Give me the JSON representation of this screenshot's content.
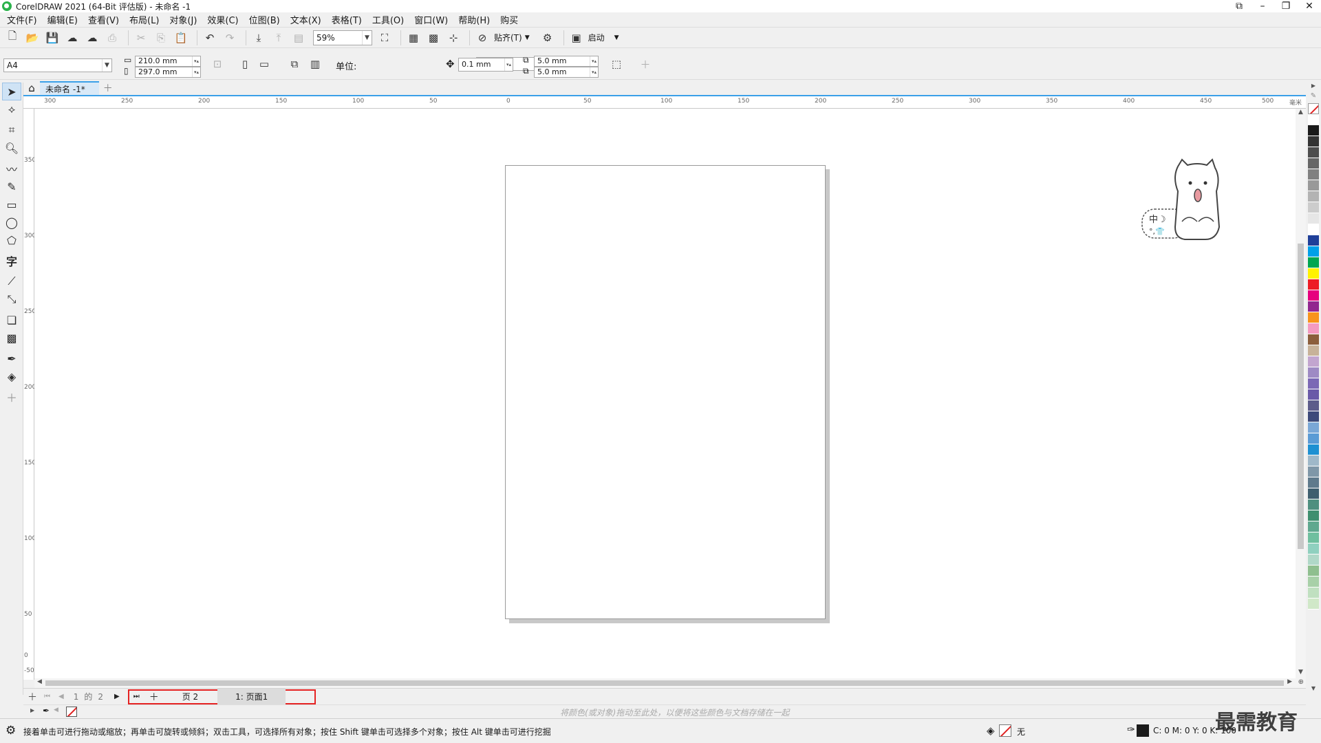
{
  "window": {
    "title": "CorelDRAW 2021 (64-Bit 评估版) - 未命名 -1",
    "app_icon": "coreldraw-logo",
    "controls": [
      "restore-icon",
      "minimize-icon",
      "maximize-icon",
      "close-icon"
    ]
  },
  "menu": {
    "items": [
      "文件(F)",
      "编辑(E)",
      "查看(V)",
      "布局(L)",
      "对象(J)",
      "效果(C)",
      "位图(B)",
      "文本(X)",
      "表格(T)",
      "工具(O)",
      "窗口(W)",
      "帮助(H)",
      "购买"
    ]
  },
  "toolbar": {
    "zoom": "59%",
    "snap_label": "贴齐(T)",
    "launch_label": "启动"
  },
  "property_bar": {
    "page_size": "A4",
    "width": "210.0 mm",
    "height": "297.0 mm",
    "unit_label": "单位:",
    "unit_value": "毫米",
    "nudge": "0.1 mm",
    "dup_x": "5.0 mm",
    "dup_y": "5.0 mm"
  },
  "tabs": {
    "document": "未命名 -1*"
  },
  "ruler": {
    "h_ticks": [
      "300",
      "250",
      "200",
      "150",
      "100",
      "50",
      "0",
      "50",
      "100",
      "150",
      "200",
      "250",
      "300",
      "350",
      "400",
      "450",
      "500"
    ],
    "unit": "毫米",
    "v_ticks": [
      "350",
      "300",
      "250",
      "200",
      "150",
      "100",
      "50",
      "0",
      "-50"
    ]
  },
  "pages": {
    "current": "1",
    "of_label": "的",
    "total": "2",
    "tabs": [
      "页 2",
      "1: 页面1"
    ]
  },
  "doc_palette": {
    "hint": "将颜色(或对象)拖动至此处，以便将这些颜色与文档存储在一起"
  },
  "status": {
    "message": "接着单击可进行拖动或缩放；再单击可旋转或倾斜；双击工具，可选择所有对象；按住 Shift 键单击可选择多个对象；按住 Alt 键单击可进行挖掘",
    "fill_label": "无",
    "color_readout": "C: 0 M: 0 Y: 0 K: 100"
  },
  "watermark": "最需教育",
  "palette_colors": [
    "#ffffff",
    "#1a1a1a",
    "#333333",
    "#4d4d4d",
    "#666666",
    "#808080",
    "#999999",
    "#b3b3b3",
    "#cccccc",
    "#e6e6e6",
    "#ffffff",
    "#1f3f99",
    "#00a0e9",
    "#00a651",
    "#fff200",
    "#ed1c24",
    "#e6007e",
    "#92278f",
    "#f7941d",
    "#f49ac1",
    "#8b5e3c",
    "#c7b299",
    "#c2a5cf",
    "#9e8ac4",
    "#7b68b5",
    "#6a5aa8",
    "#5c5c8a",
    "#3d4a7a",
    "#7aa7d6",
    "#5b9bd5",
    "#1e90d2",
    "#9fb8c9",
    "#7f97a8",
    "#5f7a8c",
    "#3f5f6f",
    "#4f8f7f",
    "#3f8f6f",
    "#5fa88f",
    "#6fbf9f",
    "#8fd0bf",
    "#b0d8c8",
    "#8fbf8f",
    "#a8d0a8",
    "#c0e0c0",
    "#d0e8c8"
  ]
}
